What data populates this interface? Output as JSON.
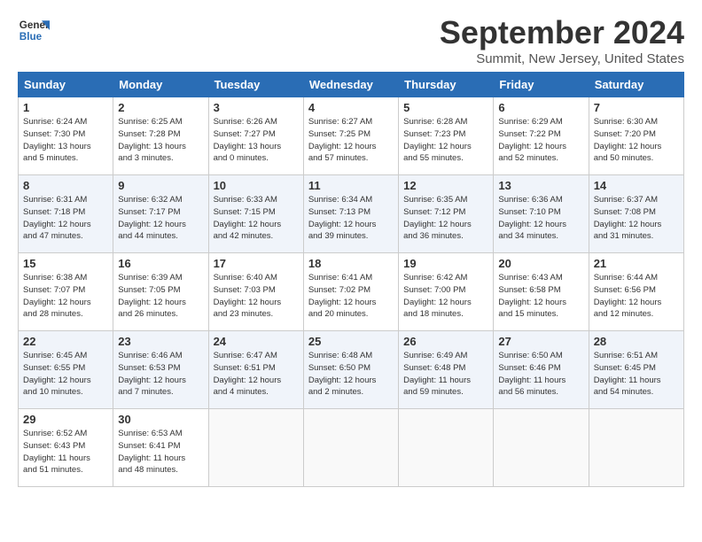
{
  "header": {
    "logo_line1": "General",
    "logo_line2": "Blue",
    "month_title": "September 2024",
    "location": "Summit, New Jersey, United States"
  },
  "days_of_week": [
    "Sunday",
    "Monday",
    "Tuesday",
    "Wednesday",
    "Thursday",
    "Friday",
    "Saturday"
  ],
  "weeks": [
    [
      {
        "day": "1",
        "info": "Sunrise: 6:24 AM\nSunset: 7:30 PM\nDaylight: 13 hours\nand 5 minutes."
      },
      {
        "day": "2",
        "info": "Sunrise: 6:25 AM\nSunset: 7:28 PM\nDaylight: 13 hours\nand 3 minutes."
      },
      {
        "day": "3",
        "info": "Sunrise: 6:26 AM\nSunset: 7:27 PM\nDaylight: 13 hours\nand 0 minutes."
      },
      {
        "day": "4",
        "info": "Sunrise: 6:27 AM\nSunset: 7:25 PM\nDaylight: 12 hours\nand 57 minutes."
      },
      {
        "day": "5",
        "info": "Sunrise: 6:28 AM\nSunset: 7:23 PM\nDaylight: 12 hours\nand 55 minutes."
      },
      {
        "day": "6",
        "info": "Sunrise: 6:29 AM\nSunset: 7:22 PM\nDaylight: 12 hours\nand 52 minutes."
      },
      {
        "day": "7",
        "info": "Sunrise: 6:30 AM\nSunset: 7:20 PM\nDaylight: 12 hours\nand 50 minutes."
      }
    ],
    [
      {
        "day": "8",
        "info": "Sunrise: 6:31 AM\nSunset: 7:18 PM\nDaylight: 12 hours\nand 47 minutes."
      },
      {
        "day": "9",
        "info": "Sunrise: 6:32 AM\nSunset: 7:17 PM\nDaylight: 12 hours\nand 44 minutes."
      },
      {
        "day": "10",
        "info": "Sunrise: 6:33 AM\nSunset: 7:15 PM\nDaylight: 12 hours\nand 42 minutes."
      },
      {
        "day": "11",
        "info": "Sunrise: 6:34 AM\nSunset: 7:13 PM\nDaylight: 12 hours\nand 39 minutes."
      },
      {
        "day": "12",
        "info": "Sunrise: 6:35 AM\nSunset: 7:12 PM\nDaylight: 12 hours\nand 36 minutes."
      },
      {
        "day": "13",
        "info": "Sunrise: 6:36 AM\nSunset: 7:10 PM\nDaylight: 12 hours\nand 34 minutes."
      },
      {
        "day": "14",
        "info": "Sunrise: 6:37 AM\nSunset: 7:08 PM\nDaylight: 12 hours\nand 31 minutes."
      }
    ],
    [
      {
        "day": "15",
        "info": "Sunrise: 6:38 AM\nSunset: 7:07 PM\nDaylight: 12 hours\nand 28 minutes."
      },
      {
        "day": "16",
        "info": "Sunrise: 6:39 AM\nSunset: 7:05 PM\nDaylight: 12 hours\nand 26 minutes."
      },
      {
        "day": "17",
        "info": "Sunrise: 6:40 AM\nSunset: 7:03 PM\nDaylight: 12 hours\nand 23 minutes."
      },
      {
        "day": "18",
        "info": "Sunrise: 6:41 AM\nSunset: 7:02 PM\nDaylight: 12 hours\nand 20 minutes."
      },
      {
        "day": "19",
        "info": "Sunrise: 6:42 AM\nSunset: 7:00 PM\nDaylight: 12 hours\nand 18 minutes."
      },
      {
        "day": "20",
        "info": "Sunrise: 6:43 AM\nSunset: 6:58 PM\nDaylight: 12 hours\nand 15 minutes."
      },
      {
        "day": "21",
        "info": "Sunrise: 6:44 AM\nSunset: 6:56 PM\nDaylight: 12 hours\nand 12 minutes."
      }
    ],
    [
      {
        "day": "22",
        "info": "Sunrise: 6:45 AM\nSunset: 6:55 PM\nDaylight: 12 hours\nand 10 minutes."
      },
      {
        "day": "23",
        "info": "Sunrise: 6:46 AM\nSunset: 6:53 PM\nDaylight: 12 hours\nand 7 minutes."
      },
      {
        "day": "24",
        "info": "Sunrise: 6:47 AM\nSunset: 6:51 PM\nDaylight: 12 hours\nand 4 minutes."
      },
      {
        "day": "25",
        "info": "Sunrise: 6:48 AM\nSunset: 6:50 PM\nDaylight: 12 hours\nand 2 minutes."
      },
      {
        "day": "26",
        "info": "Sunrise: 6:49 AM\nSunset: 6:48 PM\nDaylight: 11 hours\nand 59 minutes."
      },
      {
        "day": "27",
        "info": "Sunrise: 6:50 AM\nSunset: 6:46 PM\nDaylight: 11 hours\nand 56 minutes."
      },
      {
        "day": "28",
        "info": "Sunrise: 6:51 AM\nSunset: 6:45 PM\nDaylight: 11 hours\nand 54 minutes."
      }
    ],
    [
      {
        "day": "29",
        "info": "Sunrise: 6:52 AM\nSunset: 6:43 PM\nDaylight: 11 hours\nand 51 minutes."
      },
      {
        "day": "30",
        "info": "Sunrise: 6:53 AM\nSunset: 6:41 PM\nDaylight: 11 hours\nand 48 minutes."
      },
      {
        "day": "",
        "info": ""
      },
      {
        "day": "",
        "info": ""
      },
      {
        "day": "",
        "info": ""
      },
      {
        "day": "",
        "info": ""
      },
      {
        "day": "",
        "info": ""
      }
    ]
  ]
}
